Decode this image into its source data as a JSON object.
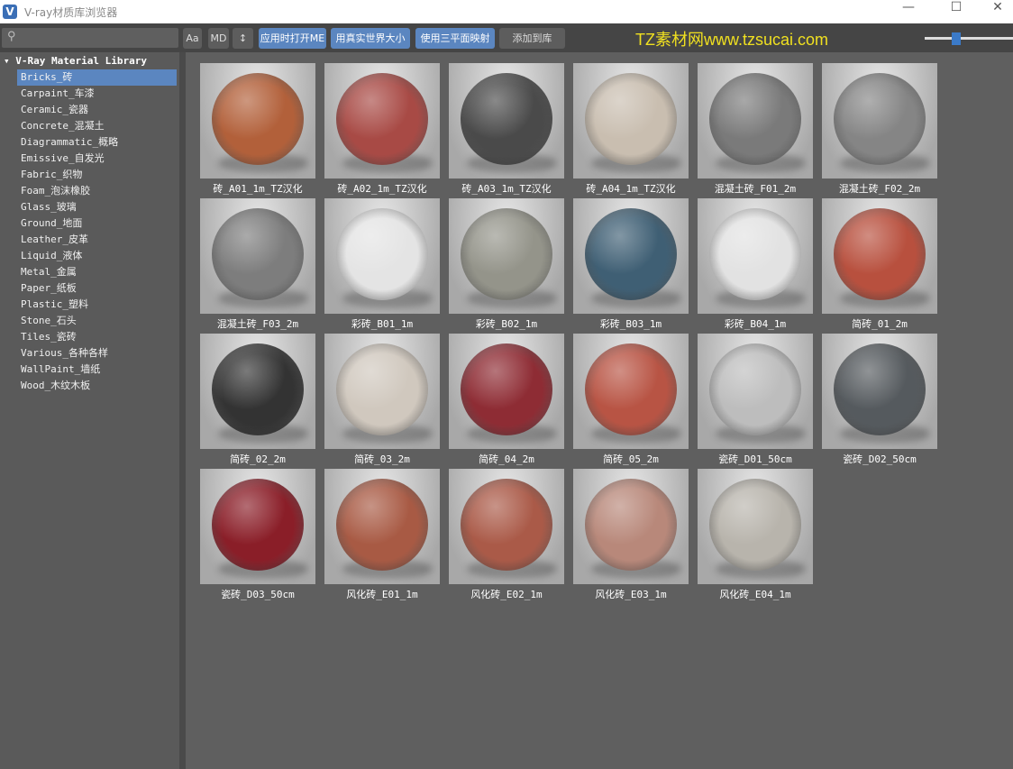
{
  "window": {
    "title": "V-ray材质库浏览器",
    "icon": "vray-logo-icon",
    "minimize": "—",
    "maximize": "☐",
    "close": "✕"
  },
  "toolbar": {
    "search_placeholder": "",
    "search_icon": "magnifier-icon",
    "aa": "Aa",
    "md": "MD",
    "sort_icon": "↕",
    "apply_open_me": "应用时打开ME",
    "real_world_size": "用真实世界大小",
    "triplanar": "使用三平面映射",
    "add_to_library": "添加到库",
    "brand": "TZ素材网www.tzsucai.com",
    "thumbnail_size_slider": 0.3,
    "accent": "#5b86c0"
  },
  "sidebar": {
    "root": "V-Ray Material Library",
    "items": [
      "Bricks_砖",
      "Carpaint_车漆",
      "Ceramic_瓷器",
      "Concrete_混凝土",
      "Diagrammatic_概略",
      "Emissive_自发光",
      "Fabric_织物",
      "Foam_泡沫橡胶",
      "Glass_玻璃",
      "Ground_地面",
      "Leather_皮革",
      "Liquid_液体",
      "Metal_金属",
      "Paper_纸板",
      "Plastic_塑料",
      "Stone_石头",
      "Tiles_瓷砖",
      "Various_各种各样",
      "WallPaint_墙纸",
      "Wood_木纹木板"
    ],
    "selected": 0
  },
  "materials": [
    {
      "name": "砖_A01_1m_TZ汉化",
      "color": "#b2603a"
    },
    {
      "name": "砖_A02_1m_TZ汉化",
      "color": "#a84a45"
    },
    {
      "name": "砖_A03_1m_TZ汉化",
      "color": "#4a4a4a"
    },
    {
      "name": "砖_A04_1m_TZ汉化",
      "color": "#c9beb0"
    },
    {
      "name": "混凝土砖_F01_2m",
      "color": "#7a7a7a"
    },
    {
      "name": "混凝土砖_F02_2m",
      "color": "#858585"
    },
    {
      "name": "混凝土砖_F03_2m",
      "color": "#7d7d7d"
    },
    {
      "name": "彩砖_B01_1m",
      "color": "#e4e4e4"
    },
    {
      "name": "彩砖_B02_1m",
      "color": "#94948a"
    },
    {
      "name": "彩砖_B03_1m",
      "color": "#3f5f74"
    },
    {
      "name": "彩砖_B04_1m",
      "color": "#e2e2e2"
    },
    {
      "name": "简砖_01_2m",
      "color": "#b8503e"
    },
    {
      "name": "简砖_02_2m",
      "color": "#333333"
    },
    {
      "name": "简砖_03_2m",
      "color": "#d0c8be"
    },
    {
      "name": "简砖_04_2m",
      "color": "#8e2c34"
    },
    {
      "name": "简砖_05_2m",
      "color": "#b85444"
    },
    {
      "name": "瓷砖_D01_50cm",
      "color": "#bdbdbd"
    },
    {
      "name": "瓷砖_D02_50cm",
      "color": "#555a5e"
    },
    {
      "name": "瓷砖_D03_50cm",
      "color": "#8a1e28"
    },
    {
      "name": "风化砖_E01_1m",
      "color": "#a85a44"
    },
    {
      "name": "风化砖_E02_1m",
      "color": "#aa5a48"
    },
    {
      "name": "风化砖_E03_1m",
      "color": "#b8887a"
    },
    {
      "name": "风化砖_E04_1m",
      "color": "#b8b4ac"
    }
  ]
}
